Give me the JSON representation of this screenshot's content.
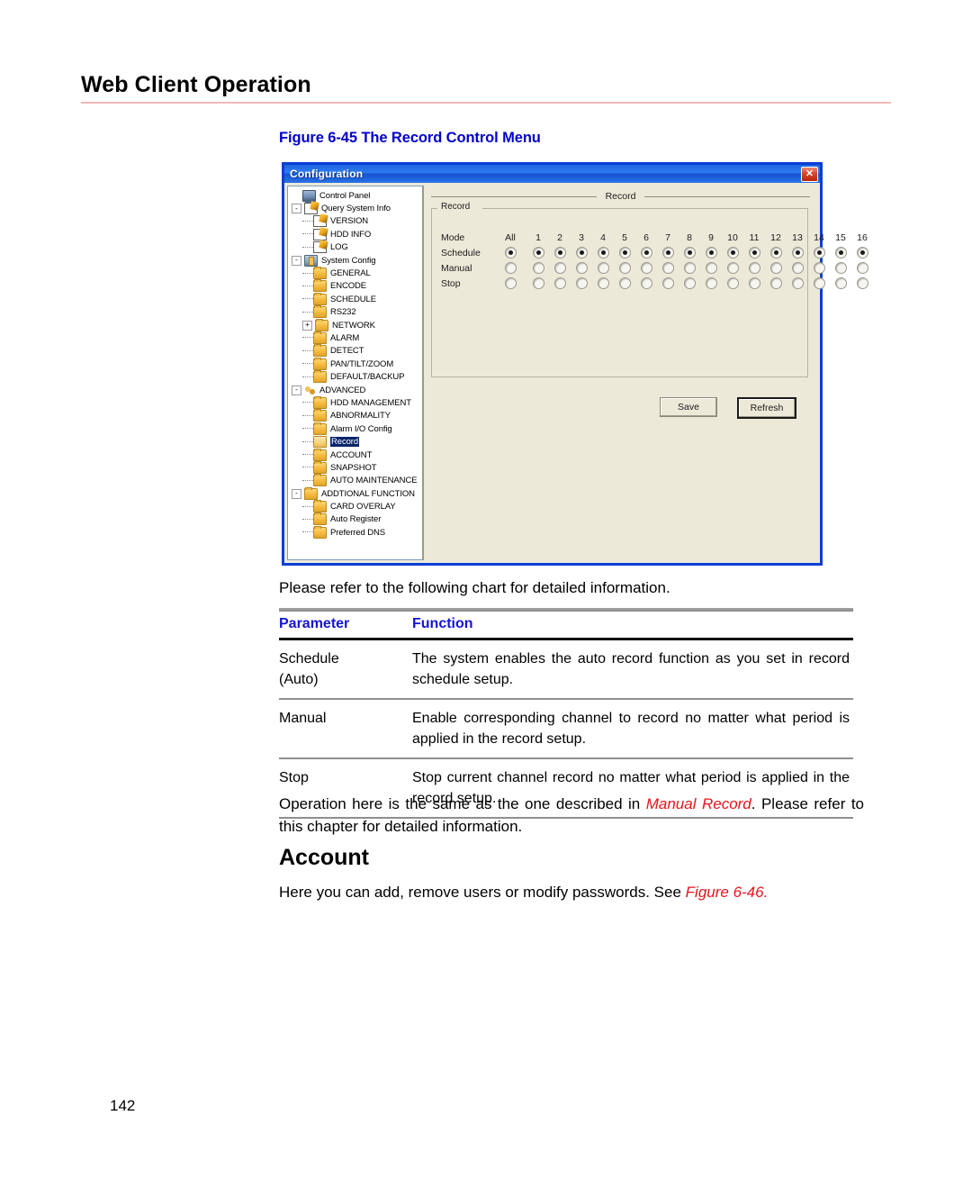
{
  "page": {
    "title": "Web Client Operation",
    "number": "142"
  },
  "figure": {
    "caption": "Figure 6-45 The Record Control Menu"
  },
  "dialog": {
    "title": "Configuration",
    "close_icon": "close-icon",
    "tree": [
      {
        "label": "Control Panel",
        "depth": 0,
        "expander": "",
        "icon": "monitor-icon"
      },
      {
        "label": "Query System Info",
        "depth": 1,
        "expander": "-",
        "icon": "note-icon"
      },
      {
        "label": "VERSION",
        "depth": 2,
        "expander": "",
        "icon": "note-icon"
      },
      {
        "label": "HDD INFO",
        "depth": 2,
        "expander": "",
        "icon": "note-icon"
      },
      {
        "label": "LOG",
        "depth": 2,
        "expander": "",
        "icon": "note-icon"
      },
      {
        "label": "System Config",
        "depth": 1,
        "expander": "-",
        "icon": "sysconfig-icon"
      },
      {
        "label": "GENERAL",
        "depth": 2,
        "expander": "",
        "icon": "folder-icon"
      },
      {
        "label": "ENCODE",
        "depth": 2,
        "expander": "",
        "icon": "folder-icon"
      },
      {
        "label": "SCHEDULE",
        "depth": 2,
        "expander": "",
        "icon": "folder-icon"
      },
      {
        "label": "RS232",
        "depth": 2,
        "expander": "",
        "icon": "folder-icon"
      },
      {
        "label": "NETWORK",
        "depth": 2,
        "expander": "+",
        "icon": "folder-icon"
      },
      {
        "label": "ALARM",
        "depth": 2,
        "expander": "",
        "icon": "folder-icon"
      },
      {
        "label": "DETECT",
        "depth": 2,
        "expander": "",
        "icon": "folder-icon"
      },
      {
        "label": "PAN/TILT/ZOOM",
        "depth": 2,
        "expander": "",
        "icon": "folder-icon"
      },
      {
        "label": "DEFAULT/BACKUP",
        "depth": 2,
        "expander": "",
        "icon": "folder-icon"
      },
      {
        "label": "ADVANCED",
        "depth": 1,
        "expander": "-",
        "icon": "gears-icon"
      },
      {
        "label": "HDD MANAGEMENT",
        "depth": 2,
        "expander": "",
        "icon": "folder-icon"
      },
      {
        "label": "ABNORMALITY",
        "depth": 2,
        "expander": "",
        "icon": "folder-icon"
      },
      {
        "label": "Alarm I/O Config",
        "depth": 2,
        "expander": "",
        "icon": "folder-icon"
      },
      {
        "label": "Record",
        "depth": 2,
        "expander": "",
        "icon": "folder-open-icon",
        "selected": true
      },
      {
        "label": "ACCOUNT",
        "depth": 2,
        "expander": "",
        "icon": "folder-icon"
      },
      {
        "label": "SNAPSHOT",
        "depth": 2,
        "expander": "",
        "icon": "folder-icon"
      },
      {
        "label": "AUTO MAINTENANCE",
        "depth": 2,
        "expander": "",
        "icon": "folder-icon"
      },
      {
        "label": "ADDTIONAL FUNCTION",
        "depth": 1,
        "expander": "-",
        "icon": "folder-icon"
      },
      {
        "label": "CARD OVERLAY",
        "depth": 2,
        "expander": "",
        "icon": "folder-icon"
      },
      {
        "label": "Auto Register",
        "depth": 2,
        "expander": "",
        "icon": "folder-icon"
      },
      {
        "label": "Preferred DNS",
        "depth": 2,
        "expander": "",
        "icon": "folder-icon"
      }
    ],
    "content": {
      "section_title": "Record",
      "fieldset_legend": "Record",
      "columns": [
        "All",
        "1",
        "2",
        "3",
        "4",
        "5",
        "6",
        "7",
        "8",
        "9",
        "10",
        "11",
        "12",
        "13",
        "14",
        "15",
        "16"
      ],
      "rows": [
        {
          "label": "Mode",
          "type": "header"
        },
        {
          "label": "Schedule",
          "type": "radio",
          "selected": true
        },
        {
          "label": "Manual",
          "type": "radio",
          "selected": false
        },
        {
          "label": "Stop",
          "type": "radio",
          "selected": false
        }
      ],
      "buttons": {
        "save": "Save",
        "refresh": "Refresh"
      }
    }
  },
  "body": {
    "intro": "Please refer to the following chart for detailed information.",
    "table": {
      "headers": [
        "Parameter",
        "Function"
      ],
      "rows": [
        {
          "parameter": "Schedule (Auto)",
          "parameter_line1": "Schedule",
          "parameter_line2": "(Auto)",
          "function": "The system enables the auto record function as you set in record schedule setup."
        },
        {
          "parameter": "Manual",
          "parameter_line1": "Manual",
          "parameter_line2": "",
          "function": "Enable corresponding channel to record no matter what period is applied in the record setup."
        },
        {
          "parameter": "Stop",
          "parameter_line1": "Stop",
          "parameter_line2": "",
          "function": "Stop current channel record no matter what period is applied in the record setup."
        }
      ]
    },
    "operation_note_pre": "Operation here is the same as the one described in ",
    "operation_note_link": "Manual Record",
    "operation_note_post": ". Please refer to this chapter for detailed information.",
    "account_heading": "Account",
    "account_text_pre": "Here you can add, remove users or modify passwords. See ",
    "account_text_link": "Figure 6-46."
  },
  "colors": {
    "heading_rule": "#f2b8b8",
    "figure_caption": "#0000cc",
    "table_header": "#1414d2",
    "cross_reference": "#e8141c",
    "titlebar": "#1b64e0",
    "dialog_bg": "#ece9d8",
    "selection": "#0a246a"
  }
}
